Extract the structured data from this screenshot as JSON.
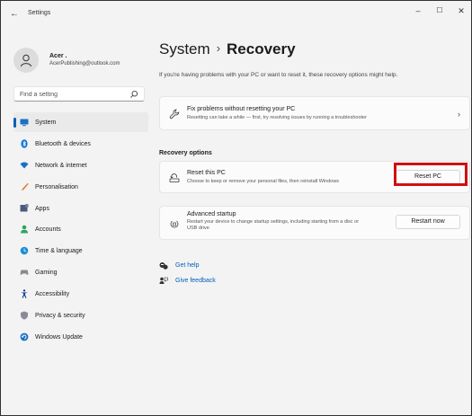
{
  "window": {
    "title": "Settings",
    "back_glyph": "←",
    "min_glyph": "–",
    "max_glyph": "☐",
    "close_glyph": "✕"
  },
  "profile": {
    "name": "Acer .",
    "email": "AcerPublishing@outlook.com"
  },
  "search": {
    "placeholder": "Find a setting"
  },
  "sidebar": {
    "items": [
      {
        "label": "System",
        "icon": "system-icon",
        "color": "#1b6fc7",
        "active": true
      },
      {
        "label": "Bluetooth & devices",
        "icon": "bluetooth-icon",
        "color": "#0a74d9"
      },
      {
        "label": "Network & internet",
        "icon": "wifi-icon",
        "color": "#1b6fc7"
      },
      {
        "label": "Personalisation",
        "icon": "brush-icon",
        "color": "#e07a2e"
      },
      {
        "label": "Apps",
        "icon": "apps-icon",
        "color": "#4b5b78"
      },
      {
        "label": "Accounts",
        "icon": "accounts-icon",
        "color": "#2fa360"
      },
      {
        "label": "Time & language",
        "icon": "globe-clock-icon",
        "color": "#1b8fd6"
      },
      {
        "label": "Gaming",
        "icon": "gaming-icon",
        "color": "#8a8a8a"
      },
      {
        "label": "Accessibility",
        "icon": "accessibility-icon",
        "color": "#1b3f8c"
      },
      {
        "label": "Privacy & security",
        "icon": "shield-icon",
        "color": "#8a8a9a"
      },
      {
        "label": "Windows Update",
        "icon": "update-icon",
        "color": "#1b6fc7"
      }
    ]
  },
  "main": {
    "breadcrumb_parent": "System",
    "breadcrumb_sep": "›",
    "breadcrumb_current": "Recovery",
    "subtitle": "If you're having problems with your PC or want to reset it, these recovery options might help.",
    "fix_card": {
      "title": "Fix problems without resetting your PC",
      "description": "Resetting can take a while — first, try resolving issues by running a troubleshooter",
      "chevron": "›"
    },
    "section_title": "Recovery options",
    "reset_card": {
      "title": "Reset this PC",
      "description": "Choose to keep or remove your personal files, then reinstall Windows",
      "button": "Reset PC"
    },
    "advanced_card": {
      "title": "Advanced startup",
      "description_line1": "Restart your device to change startup settings, including starting from a disc or",
      "description_line2": "USB drive",
      "button": "Restart now"
    },
    "links": [
      {
        "label": "Get help",
        "icon": "help-icon"
      },
      {
        "label": "Give feedback",
        "icon": "feedback-icon"
      }
    ]
  },
  "colors": {
    "accent": "#005fb8",
    "highlight_box": "#d01010"
  }
}
